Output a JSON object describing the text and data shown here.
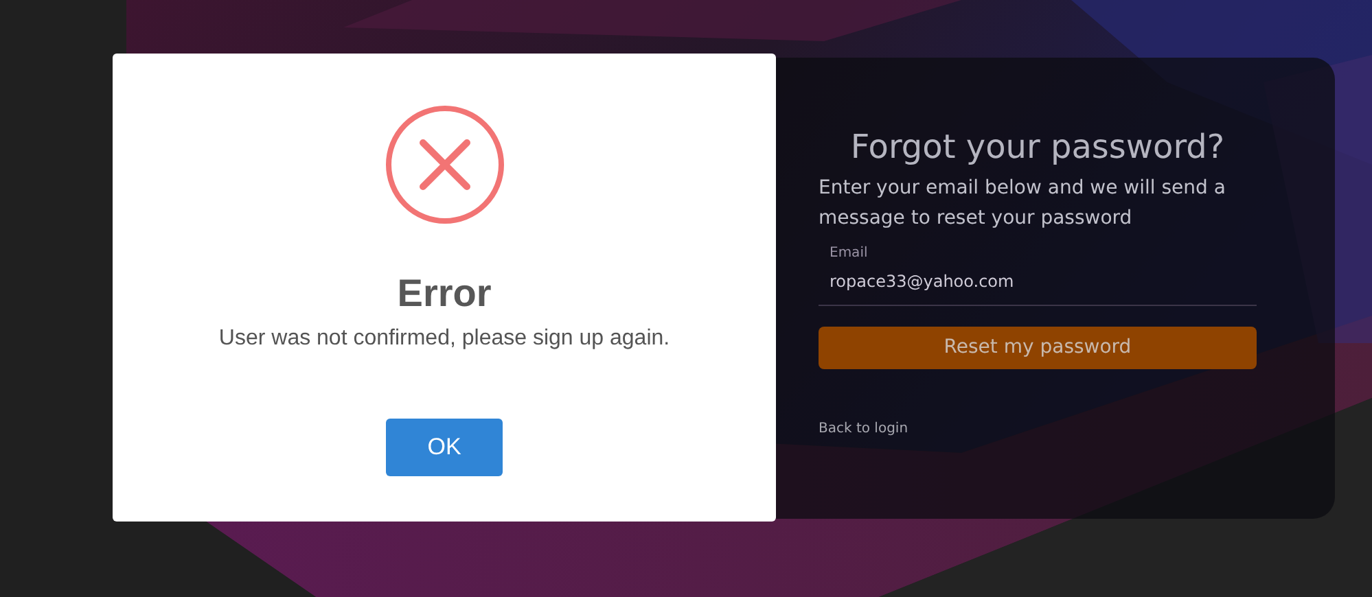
{
  "reset_card": {
    "title": "Forgot your password?",
    "description": "Enter your email below and we will send a message to reset your password",
    "email_field": {
      "label": "Email",
      "value": "ropace33@yahoo.com"
    },
    "submit_button": "Reset my password",
    "back_link": "Back to login"
  },
  "error_dialog": {
    "title": "Error",
    "message": "User was not confirmed, please sign up again.",
    "button": "OK"
  }
}
